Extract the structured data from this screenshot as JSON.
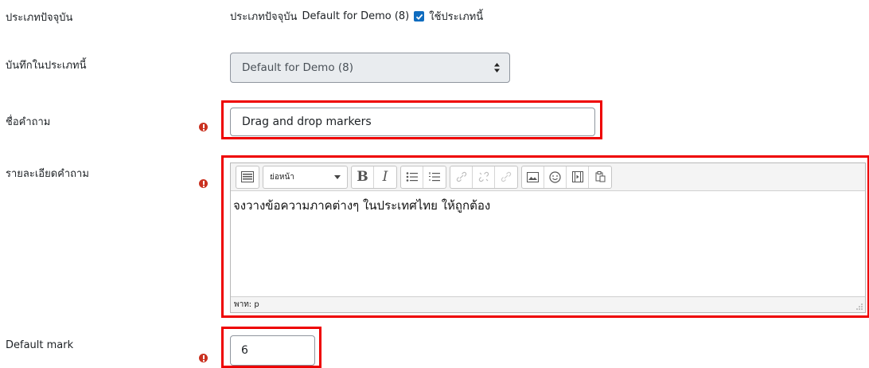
{
  "current_category": {
    "label": "ประเภทปัจจุบัน",
    "prefix": "ประเภทปัจจุบัน",
    "value": "Default for Demo (8)",
    "use_this_checkbox_label": "ใช้ประเภทนี้",
    "use_this_checked": true
  },
  "save_in_category": {
    "label": "บันทึกในประเภทนี้",
    "selected": "Default for Demo (8)"
  },
  "question_name": {
    "label": "ชื่อคำถาม",
    "value": "Drag and drop markers"
  },
  "question_text": {
    "label": "รายละเอียดคำถาม",
    "format_select": "ย่อหน้า",
    "content": "จงวางข้อความภาคต่างๆ ในประเทศไทย ให้ถูกต้อง",
    "path": "พาท: p"
  },
  "default_mark": {
    "label": "Default mark",
    "value": "6"
  },
  "colors": {
    "highlight": "#ee0000",
    "required": "#ca3120",
    "accent": "#0f6cbf"
  }
}
